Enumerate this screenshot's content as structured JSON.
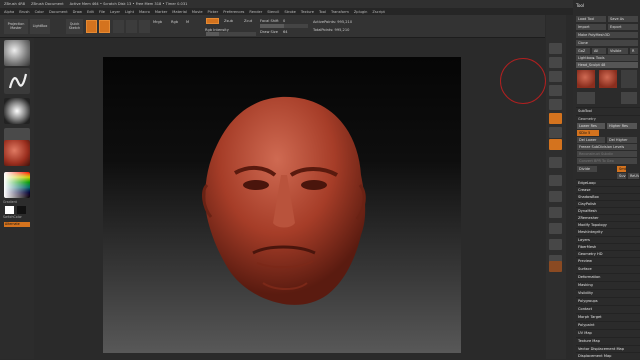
{
  "titlebar": {
    "app": "ZBrush 4R8",
    "doc": "ZBrush Document",
    "info": "Active Mem 464 • Scratch Disk 13 • Free Mem 318 • Timer 0.031",
    "buttons": [
      "QuickSave",
      "DefaultZScript"
    ]
  },
  "menubar": [
    "Alpha",
    "Brush",
    "Color",
    "Document",
    "Draw",
    "Edit",
    "File",
    "Layer",
    "Light",
    "Macro",
    "Marker",
    "Material",
    "Movie",
    "Picker",
    "Preferences",
    "Render",
    "Stencil",
    "Stroke",
    "Texture",
    "Tool",
    "Transform",
    "Zplugin",
    "Zscript"
  ],
  "shelf": {
    "projection_master": "Projection Master",
    "lightbox": "LightBox",
    "quick_sketch": "Quick Sketch",
    "edit": "Edit",
    "draw": "Draw",
    "move": "Move",
    "scale": "Scale",
    "rotate": "Rotate",
    "mrgb": "Mrgb",
    "rgb": "Rgb",
    "m": "M",
    "zadd": "Zadd",
    "zsub": "Zsub",
    "zcut": "Zcut",
    "focal_label": "Focal Shift",
    "focal_value": "0",
    "draw_size_label": "Draw Size",
    "draw_size_value": "64",
    "rgb_int_label": "Rgb Intensity",
    "rgb_int_value": "100",
    "z_int_label": "Z Intensity",
    "z_int_value": "25",
    "active_points": "ActivePoints: 995,210",
    "total_points": "TotalPoints: 995,210"
  },
  "left": {
    "materials": [
      "Standard",
      "SkinShade4"
    ],
    "gradient": "Gradient",
    "switch_color": "SwitchColor",
    "alternate": "Alternate"
  },
  "panel": {
    "title": "Tool",
    "load": "Load Tool",
    "save_as": "Save As",
    "copy": "Copy",
    "paste": "Paste",
    "import": "Import",
    "export": "Export",
    "clone": "Clone",
    "make_polymesh": "Make PolyMesh3D",
    "goz": "GoZ",
    "all": "All",
    "visible": "Visible",
    "r": "R",
    "lightbox_tools": "Lightbox▸ Tools",
    "current_tool": "Head_Sculpt 48",
    "subtools_label": "SubTool",
    "geometry": "Geometry",
    "lower_res": "Lower Res",
    "higher_res": "Higher Res",
    "sdiv": "SDiv 5",
    "del_lower": "Del Lower",
    "del_higher": "Del Higher",
    "freeze": "Freeze SubDivision Levels",
    "reconstruct": "Reconstruct Subdiv",
    "convert": "Convert BPR To Geo",
    "divide": "Divide",
    "smt": "Smt",
    "suv": "Suv",
    "reuv": "ReUV",
    "geo_items": [
      "EdgeLoop",
      "Crease",
      "ShadowBox",
      "ClayPolish",
      "DynaMesh",
      "ZRemesher",
      "Modify Topology",
      "MeshIntegrity"
    ],
    "sections": [
      "Layers",
      "FiberMesh",
      "Geometry HD",
      "Preview",
      "Surface",
      "Deformation",
      "Masking",
      "Visibility",
      "Polygroups",
      "Contact",
      "Morph Target",
      "Polypaint",
      "UV Map",
      "Texture Map",
      "Vector Displacement Map",
      "Displacement Map"
    ]
  },
  "colors": {
    "accent": "#d4731e",
    "panel_bg": "#2b2b2b",
    "head": "#b5472f"
  }
}
